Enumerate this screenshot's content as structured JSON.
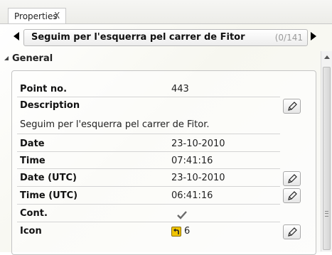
{
  "tab": {
    "label": "Properties",
    "close": "X"
  },
  "navigator": {
    "title": "Seguim per l'esquerra pel carrer de Fitor",
    "counter": "(0/141"
  },
  "section": {
    "title": "General"
  },
  "fields": {
    "point_no": {
      "label": "Point no.",
      "value": "443"
    },
    "description": {
      "label": "Description",
      "value": "Seguim per l'esquerra pel carrer de Fitor."
    },
    "date": {
      "label": "Date",
      "value": "23-10-2010"
    },
    "time": {
      "label": "Time",
      "value": "07:41:16"
    },
    "date_utc": {
      "label": "Date (UTC)",
      "value": "23-10-2010"
    },
    "time_utc": {
      "label": "Time (UTC)",
      "value": "06:41:16"
    },
    "cont": {
      "label": "Cont.",
      "checked": true
    },
    "icon": {
      "label": "Icon",
      "value": "6",
      "icon_name": "turn-left-arrow-icon"
    }
  },
  "colors": {
    "icon_badge": "#f0c400",
    "counter_text": "#9a9a9a"
  }
}
